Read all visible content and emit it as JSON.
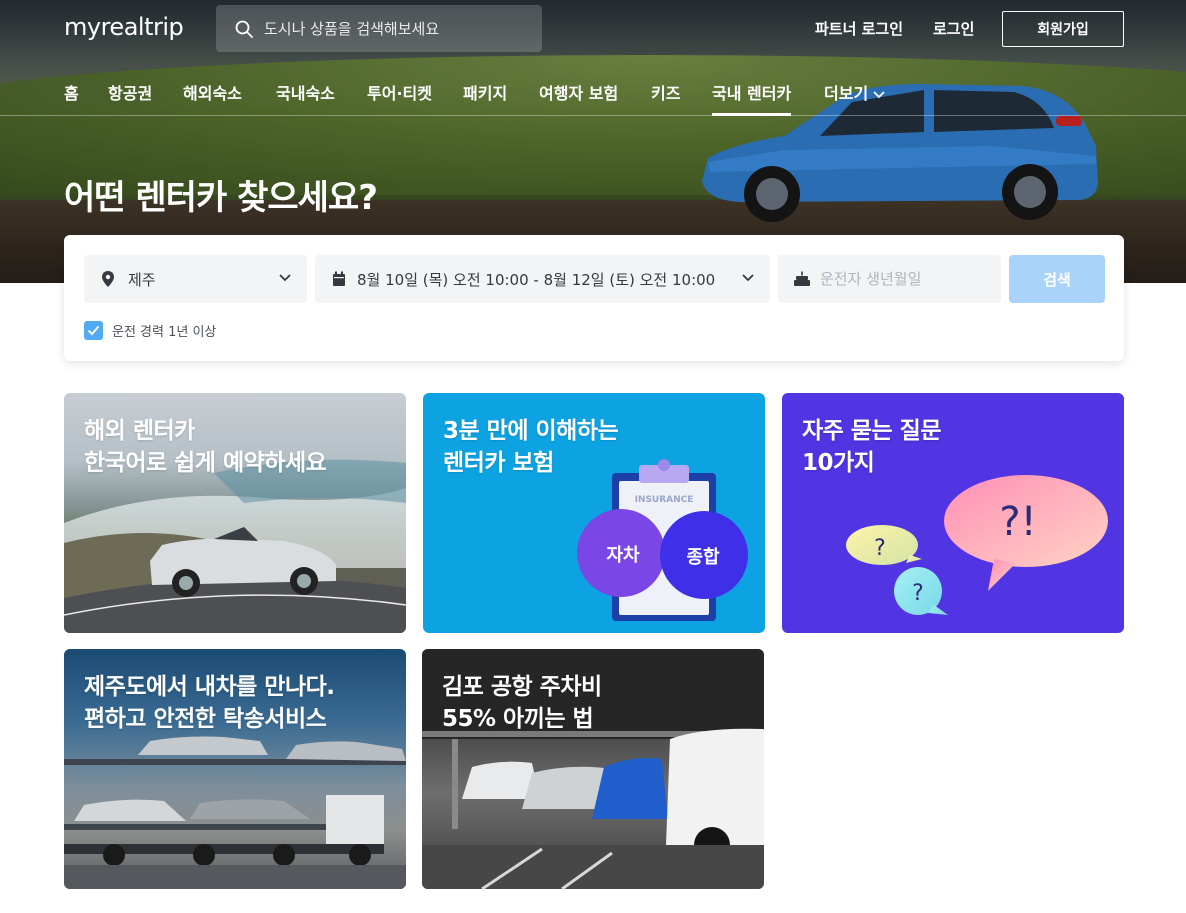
{
  "brand": {
    "logo": "myrealtrip"
  },
  "search": {
    "placeholder": "도시나 상품을 검색해보세요"
  },
  "header_links": {
    "partner_login": "파트너 로그인",
    "login": "로그인",
    "signup": "회원가입"
  },
  "nav": [
    {
      "label": "홈"
    },
    {
      "label": "항공권"
    },
    {
      "label": "해외숙소"
    },
    {
      "label": "국내숙소"
    },
    {
      "label": "투어·티켓"
    },
    {
      "label": "패키지"
    },
    {
      "label": "여행자 보험"
    },
    {
      "label": "키즈"
    },
    {
      "label": "국내 렌터카",
      "active": true
    },
    {
      "label": "더보기"
    }
  ],
  "hero": {
    "headline": "어떤 렌터카 찾으세요?"
  },
  "form": {
    "location": "제주",
    "dates": "8월 10일 (목) 오전 10:00 - 8월 12일 (토) 오전 10:00",
    "birth_placeholder": "운전자 생년월일",
    "search_button": "검색",
    "experience_label": "운전 경력 1년 이상",
    "experience_checked": true
  },
  "cards": [
    {
      "title": "해외 렌터카\n한국어로 쉽게 예약하세요"
    },
    {
      "title": "3분 만에 이해하는\n렌터카 보험",
      "insurance_label": "INSURANCE",
      "bubble_left": "자차",
      "bubble_right": "종합"
    },
    {
      "title": "자주 묻는 질문\n10가지",
      "bubble_big": "?!",
      "bubble_small": "?"
    },
    {
      "title": "제주도에서 내차를 만나다.\n편하고 안전한 탁송서비스"
    },
    {
      "title": "김포 공항 주차비\n55% 아끼는 법"
    }
  ],
  "colors": {
    "accent": "#51abf3",
    "search_button_disabled": "#a9d3fa",
    "card_insurance": "#0da3e3",
    "card_faq": "#5134e2"
  }
}
